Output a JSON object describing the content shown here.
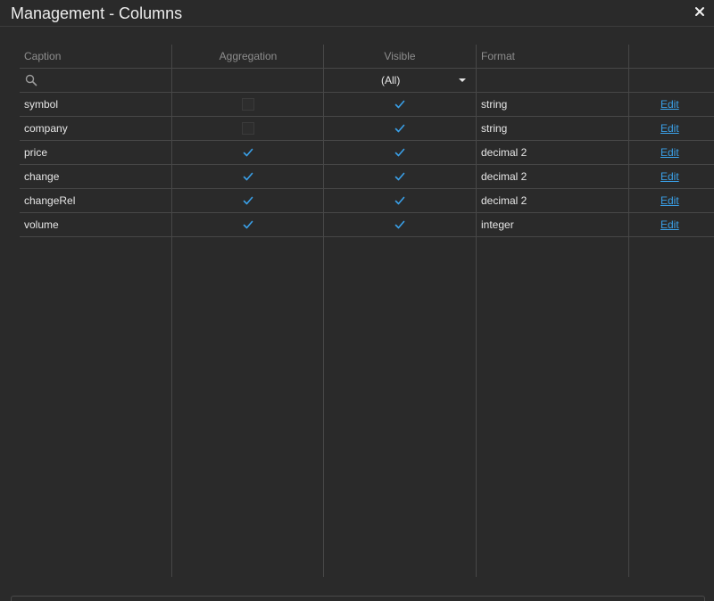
{
  "window": {
    "title": "Management - Columns",
    "close_icon": "close-icon"
  },
  "grid": {
    "columns": [
      "Caption",
      "Aggregation",
      "Visible",
      "Format",
      ""
    ],
    "filter": {
      "caption_placeholder": "",
      "visible_value": "(All)"
    },
    "edit_label": "Edit",
    "rows": [
      {
        "caption": "symbol",
        "aggregation": false,
        "visible": true,
        "format": "string",
        "edit": "Edit"
      },
      {
        "caption": "company",
        "aggregation": false,
        "visible": true,
        "format": "string",
        "edit": "Edit"
      },
      {
        "caption": "price",
        "aggregation": true,
        "visible": true,
        "format": "decimal 2",
        "edit": "Edit"
      },
      {
        "caption": "change",
        "aggregation": true,
        "visible": true,
        "format": "decimal 2",
        "edit": "Edit"
      },
      {
        "caption": "changeRel",
        "aggregation": true,
        "visible": true,
        "format": "decimal 2",
        "edit": "Edit"
      },
      {
        "caption": "volume",
        "aggregation": true,
        "visible": true,
        "format": "integer",
        "edit": "Edit"
      }
    ]
  },
  "colors": {
    "background": "#2a2a2a",
    "grid_line": "#474747",
    "header_text": "#8e8e8e",
    "link": "#3aa0e8",
    "check": "#3aa0e8"
  }
}
